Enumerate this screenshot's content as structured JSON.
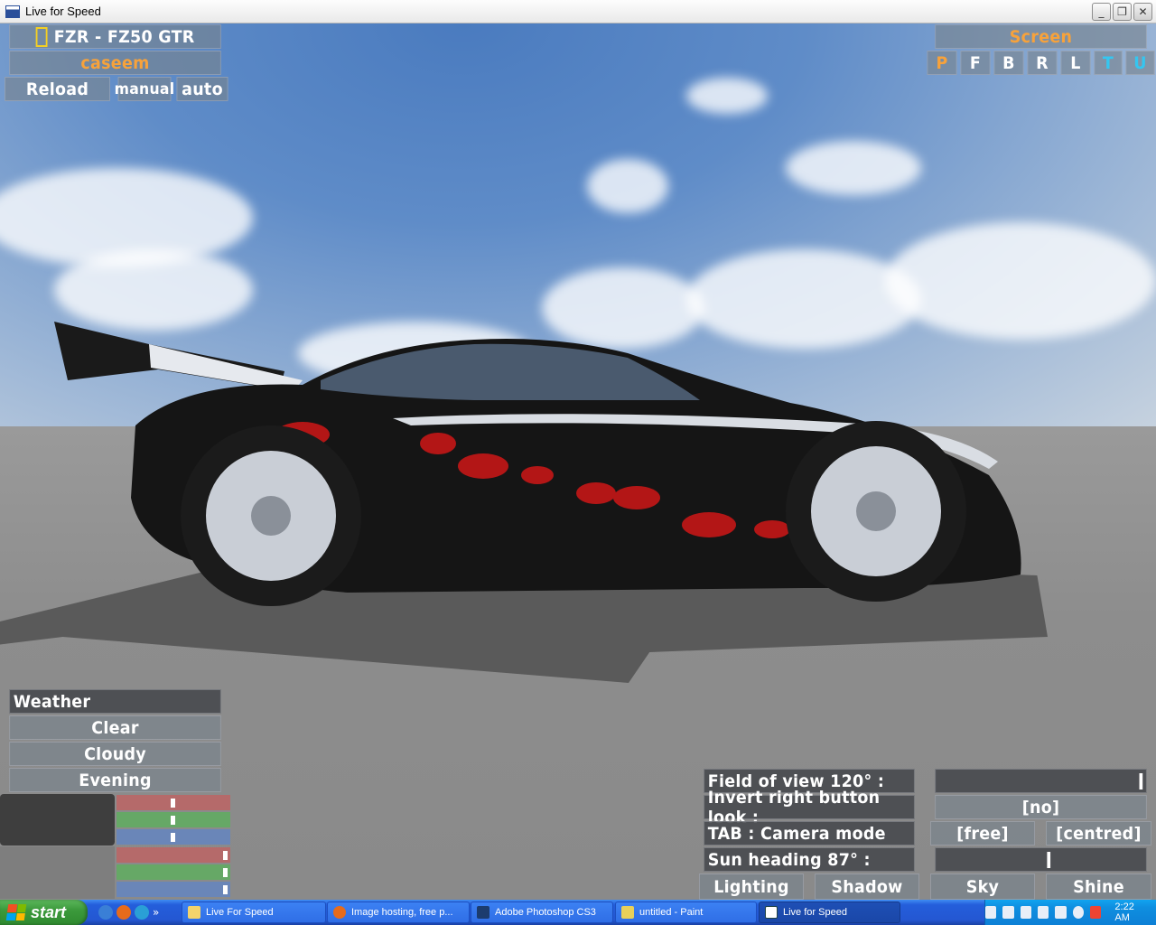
{
  "window": {
    "title": "Live for Speed",
    "minimize_label": "_",
    "restore_label": "❐",
    "close_label": "✕"
  },
  "car_select": {
    "car_name": "FZR - FZ50 GTR",
    "skin_name": "caseem",
    "reload_label": "Reload",
    "manual_label": "manual",
    "auto_label": "auto"
  },
  "screen_panel": {
    "title": "Screen",
    "buttons": [
      "P",
      "F",
      "B",
      "R",
      "L",
      "T",
      "U"
    ]
  },
  "weather": {
    "header": "Weather",
    "options": [
      "Clear",
      "Cloudy",
      "Evening"
    ],
    "colors": {
      "swatch_top": "#3e3e3e",
      "swatch_bottom": "#7e7e7e",
      "red": "#b56a6a",
      "green": "#66a866",
      "blue": "#6a86b8"
    }
  },
  "view_options": {
    "fov_label": "Field of view 120° :",
    "invert_label": "Invert right button look :",
    "invert_value": "[no]",
    "camera_label": "TAB : Camera mode",
    "camera_free": "[free]",
    "camera_centred": "[centred]",
    "sun_label": "Sun heading 87° :",
    "fov_value": 120,
    "sun_heading": 87,
    "tabs": [
      "Lighting",
      "Shadow",
      "Sky",
      "Shine"
    ]
  },
  "taskbar": {
    "start_label": "start",
    "quicklaunch_more": "»",
    "items": [
      {
        "label": "Live For Speed"
      },
      {
        "label": "Image hosting, free p..."
      },
      {
        "label": "Adobe Photoshop CS3"
      },
      {
        "label": "untitled - Paint"
      },
      {
        "label": "Live for Speed"
      }
    ],
    "clock": "2:22 AM"
  }
}
